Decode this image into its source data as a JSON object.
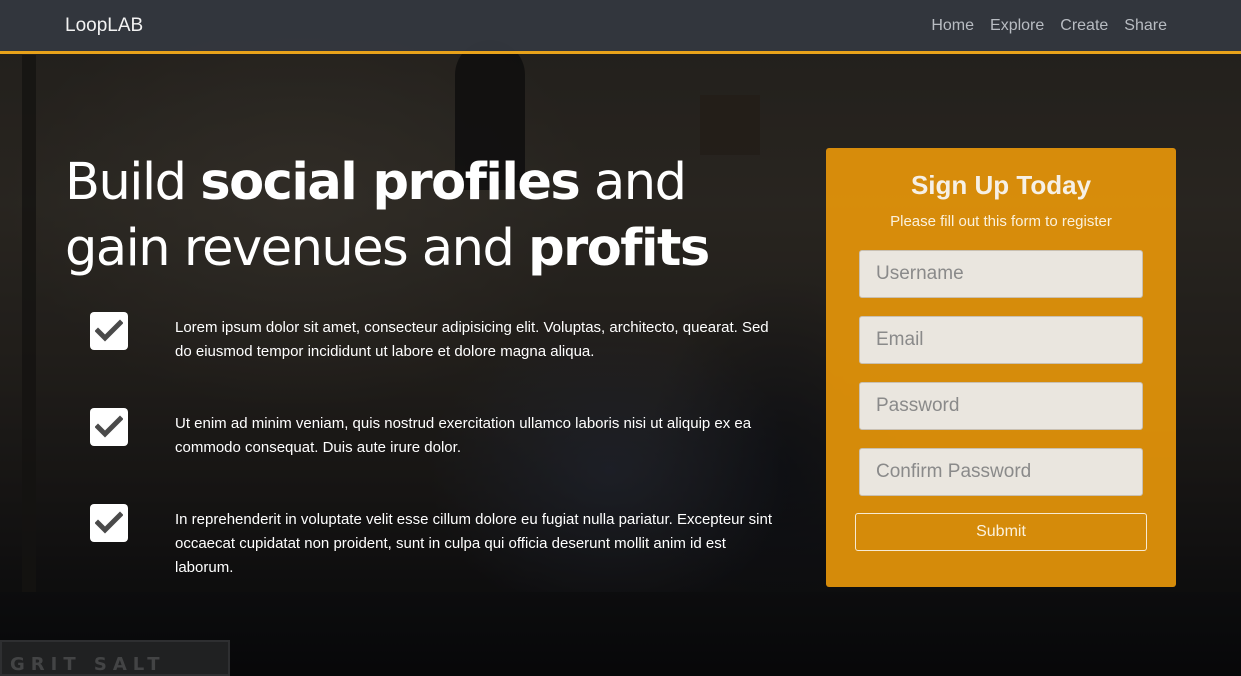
{
  "nav": {
    "brand": "LoopLAB",
    "links": [
      "Home",
      "Explore",
      "Create",
      "Share"
    ]
  },
  "hero": {
    "headline_part1": "Build ",
    "headline_bold1": "social profiles",
    "headline_part2": " and gain revenues and ",
    "headline_bold2": "profits",
    "features": [
      "Lorem ipsum dolor sit amet, consecteur adipisicing elit. Voluptas, architecto, quearat. Sed do eiusmod tempor incididunt ut labore et dolore magna aliqua.",
      "Ut enim ad minim veniam, quis nostrud exercitation ullamco laboris nisi ut aliquip ex ea commodo consequat. Duis aute irure dolor.",
      "In reprehenderit in voluptate velit esse cillum dolore eu fugiat nulla pariatur. Excepteur sint occaecat cupidatat non proident, sunt in culpa qui officia deserunt mollit anim id est laborum."
    ],
    "background_sign": "GRIT SALT"
  },
  "signup": {
    "title": "Sign Up Today",
    "subtitle": "Please fill out this form to register",
    "username_placeholder": "Username",
    "email_placeholder": "Email",
    "password_placeholder": "Password",
    "confirm_placeholder": "Confirm Password",
    "submit_label": "Submit"
  },
  "colors": {
    "accent": "#e8a21a",
    "card": "#e6960a",
    "navbar": "#343840"
  },
  "icons": [
    "check-icon"
  ]
}
